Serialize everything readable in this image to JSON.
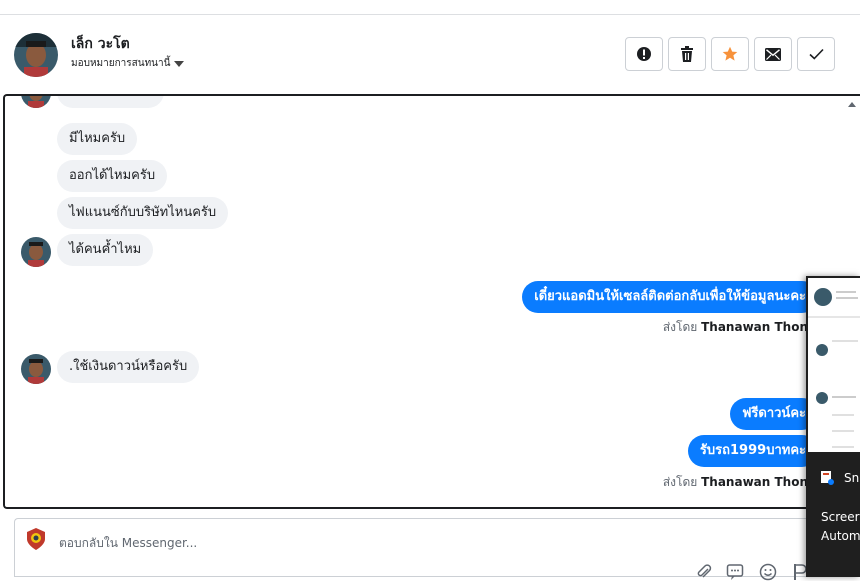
{
  "header": {
    "name": "เล็ก วะโต",
    "assign_label": "มอบหมายการสนทนานี้"
  },
  "toolbar": {
    "spam_icon": "alert-icon",
    "delete_icon": "trash-icon",
    "star_icon": "star-icon",
    "unread_icon": "envelope-icon",
    "done_icon": "check-icon",
    "star_color": "#f7923b"
  },
  "messages": {
    "in_1": "มีไหมครับ",
    "in_2": "ออกได้ไหมครับ",
    "in_3": "ไฟแนนซ์กับบริษัทไหนครับ",
    "in_4": "ได้คนค้ำไหม",
    "out_1": "เดี๋ยวแอดมินให้เซลล์ติดต่อกลับเพื่อให้ข้อมูลนะคะ",
    "in_5": ".ใช้เงินดาวน์หรือครับ",
    "out_2": "ฟรีดาวน์คะ",
    "out_3": "รับรถ1999บาทคะ",
    "sent_by_prefix": "ส่งโดย",
    "sent_by_name": "Thanawan Thon",
    "out_color": "#0a7cff"
  },
  "composer": {
    "placeholder": "ตอบกลับใน Messenger..."
  },
  "snip_popup": {
    "title": "Sn",
    "line1": "Screer",
    "line2": "Autom"
  }
}
